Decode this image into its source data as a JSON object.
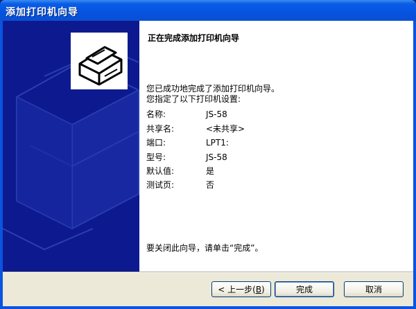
{
  "window": {
    "title": "添加打印机向导"
  },
  "content": {
    "heading": "正在完成添加打印机向导",
    "intro_line1": "您已成功地完成了添加打印机向导。",
    "intro_line2": "您指定了以下打印机设置:",
    "settings": [
      {
        "label": "名称:",
        "value": "JS-58"
      },
      {
        "label": "共享名:",
        "value": "<未共享>"
      },
      {
        "label": "端口:",
        "value": "LPT1:"
      },
      {
        "label": "型号:",
        "value": "JS-58"
      },
      {
        "label": "默认值:",
        "value": "是"
      },
      {
        "label": "测试页:",
        "value": "否"
      }
    ],
    "closing": "要关闭此向导，请单击“完成”。"
  },
  "buttons": {
    "back": {
      "prefix": "< 上一步(",
      "key": "B",
      "suffix": ")"
    },
    "finish": "完成",
    "cancel": "取消"
  },
  "colors": {
    "sidebar": "#0d1a8f",
    "titlebar": "#0553e0",
    "face": "#ece9d8"
  },
  "icons": {
    "wizard": "printer-icon"
  }
}
